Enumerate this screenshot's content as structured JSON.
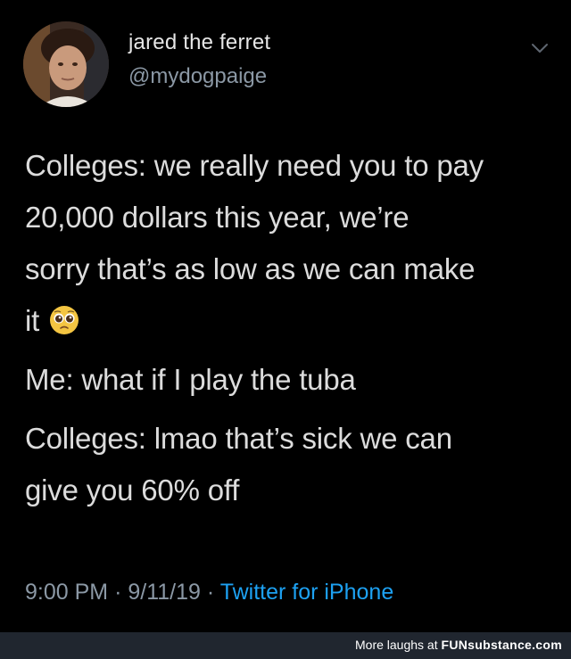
{
  "user": {
    "name": "jared the ferret",
    "handle": "@mydogpaige",
    "avatar_icon": "profile-photo"
  },
  "menu_icon": "chevron-down-icon",
  "tweet": {
    "lines": [
      "Colleges: we really need you to pay",
      "20,000 dollars this year, we’re",
      "sorry that’s as low as we can make",
      "it",
      "Me: what if I play the tuba",
      "Colleges: lmao that’s sick we can",
      "give you 60% off"
    ],
    "emoji": "pleading-face-icon"
  },
  "meta": {
    "time": "9:00 PM",
    "separator": "·",
    "date": "9/11/19",
    "source": "Twitter for iPhone"
  },
  "footer": {
    "prefix": "More laughs at",
    "brand": "FUNsubstance.com"
  },
  "colors": {
    "background": "#000000",
    "secondary_text": "#8b98a5",
    "link": "#1da1f2",
    "footer_bg": "#20262f"
  }
}
